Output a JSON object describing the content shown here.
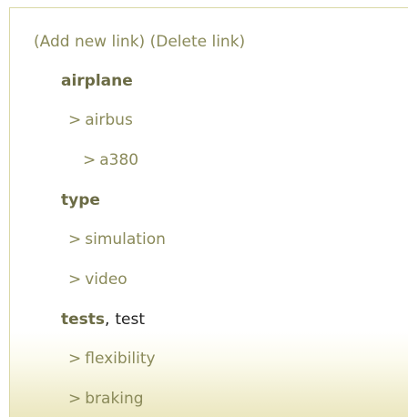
{
  "actions": {
    "add_label": "(Add new link)",
    "delete_label": "(Delete link)"
  },
  "tree": [
    {
      "name": "airplane"
    },
    {
      "name": "airbus",
      "prefix": ">"
    },
    {
      "name": "a380",
      "prefix": ">"
    },
    {
      "name": "type"
    },
    {
      "name": "simulation",
      "prefix": ">"
    },
    {
      "name": "video",
      "prefix": ">"
    },
    {
      "name": "tests",
      "separator": ",",
      "alias": "test"
    },
    {
      "name": "flexibility",
      "prefix": ">"
    },
    {
      "name": "braking",
      "prefix": ">"
    }
  ],
  "colors": {
    "category": "#6b6b45",
    "link": "#8a8a5a",
    "border": "#dad8a6"
  }
}
